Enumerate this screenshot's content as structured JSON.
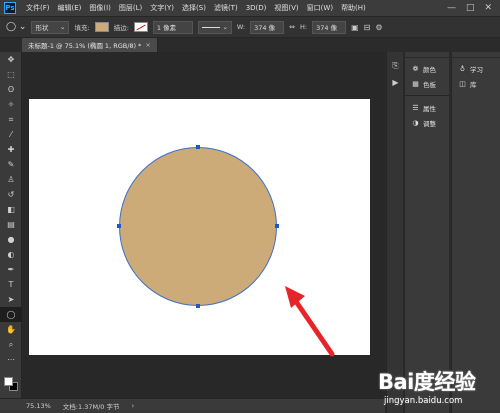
{
  "menubar": {
    "logo": "Ps",
    "items": [
      "文件(F)",
      "编辑(E)",
      "图像(I)",
      "图层(L)",
      "文字(Y)",
      "选择(S)",
      "滤镜(T)",
      "3D(D)",
      "视图(V)",
      "窗口(W)",
      "帮助(H)"
    ],
    "window_controls": [
      "—",
      "□",
      "✕"
    ]
  },
  "options": {
    "shape_mode": "形状",
    "fill_label": "填充:",
    "stroke_label": "描边:",
    "stroke_width": "1 像素",
    "w_label": "W:",
    "w_value": "374 像",
    "h_label": "H:",
    "h_value": "374 像",
    "fill_color": "#cdab78"
  },
  "document": {
    "tab_title": "未标题-1 @ 75.1% (椭圆 1, RGB/8) *",
    "close": "×"
  },
  "status": {
    "zoom": "75.13%",
    "doc_info": "文档:1.37M/0 字节",
    "arrow": "›"
  },
  "tools": [
    {
      "name": "move-tool",
      "glyph": "✥"
    },
    {
      "name": "marquee-tool",
      "glyph": "⬚"
    },
    {
      "name": "lasso-tool",
      "glyph": "ʘ"
    },
    {
      "name": "magic-wand-tool",
      "glyph": "✧"
    },
    {
      "name": "crop-tool",
      "glyph": "⌗"
    },
    {
      "name": "eyedropper-tool",
      "glyph": "⁄"
    },
    {
      "name": "healing-tool",
      "glyph": "✚"
    },
    {
      "name": "brush-tool",
      "glyph": "✎"
    },
    {
      "name": "clone-stamp-tool",
      "glyph": "♙"
    },
    {
      "name": "history-brush-tool",
      "glyph": "↺"
    },
    {
      "name": "eraser-tool",
      "glyph": "◧"
    },
    {
      "name": "gradient-tool",
      "glyph": "▤"
    },
    {
      "name": "blur-tool",
      "glyph": "●"
    },
    {
      "name": "dodge-tool",
      "glyph": "◐"
    },
    {
      "name": "pen-tool",
      "glyph": "✒"
    },
    {
      "name": "type-tool",
      "glyph": "T"
    },
    {
      "name": "path-selection-tool",
      "glyph": "➤"
    },
    {
      "name": "ellipse-tool",
      "glyph": "◯"
    },
    {
      "name": "hand-tool",
      "glyph": "✋"
    },
    {
      "name": "zoom-tool",
      "glyph": "⌕"
    },
    {
      "name": "more-tools",
      "glyph": "⋯"
    }
  ],
  "panels": {
    "color": "颜色",
    "swatches": "色板",
    "properties": "属性",
    "adjustments": "调整",
    "learn": "学习",
    "libraries": "库"
  },
  "watermark": {
    "logo": "Bai度经验",
    "url": "jingyan.baidu.com"
  }
}
